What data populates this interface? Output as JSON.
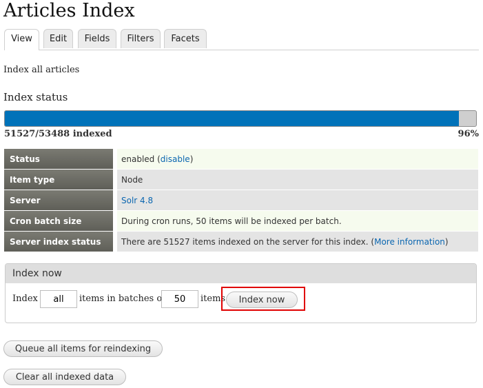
{
  "page": {
    "title": "Articles Index"
  },
  "tabs": [
    {
      "label": "View",
      "active": true
    },
    {
      "label": "Edit",
      "active": false
    },
    {
      "label": "Fields",
      "active": false
    },
    {
      "label": "Filters",
      "active": false
    },
    {
      "label": "Facets",
      "active": false
    }
  ],
  "intro_text": "Index all articles",
  "status_heading": "Index status",
  "progress": {
    "indexed_label": "51527/53488 indexed",
    "percent_label": "96%",
    "fraction": 0.963
  },
  "info": {
    "status": {
      "label": "Status",
      "value_prefix": "enabled (",
      "link": "disable",
      "value_suffix": ")"
    },
    "item_type": {
      "label": "Item type",
      "value": "Node"
    },
    "server": {
      "label": "Server",
      "link": "Solr 4.8"
    },
    "cron": {
      "label": "Cron batch size",
      "value": "During cron runs, 50 items will be indexed per batch."
    },
    "server_status": {
      "label": "Server index status",
      "value_prefix": "There are 51527 items indexed on the server for this index. (",
      "link": "More information",
      "value_suffix": ")"
    }
  },
  "index_now": {
    "legend": "Index now",
    "label_before": "Index",
    "limit_value": "all",
    "label_middle": "items in batches of",
    "batch_value": "50",
    "label_after": "items",
    "button": "Index now"
  },
  "actions": {
    "queue_button": "Queue all items for reindexing",
    "clear_button": "Clear all indexed data"
  },
  "colors": {
    "progress_fill": "#0072b9",
    "highlight": "#e00000",
    "link": "#0a66b0"
  }
}
